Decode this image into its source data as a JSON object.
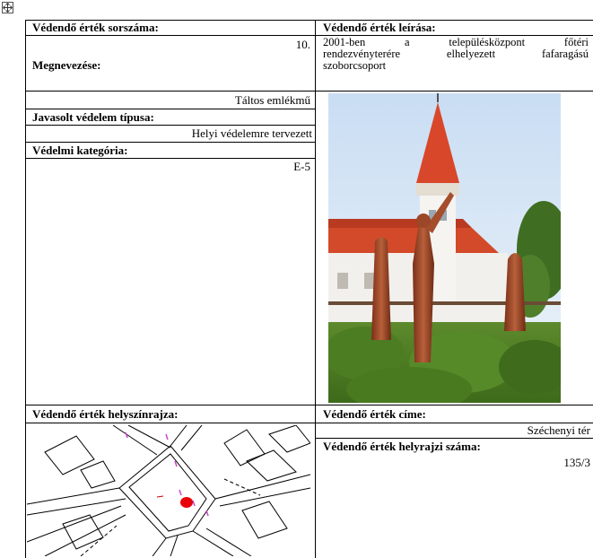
{
  "left_column": {
    "serial_label": "Védendő érték sorszáma:",
    "serial_value": "10.",
    "name_label": "Megnevezése:",
    "name_value": "Táltos emlékmű",
    "protection_type_label": "Javasolt védelem típusa:",
    "protection_type_value": "Helyi védelemre tervezett",
    "category_label": "Védelmi kategória:",
    "category_value": "E-5",
    "site_plan_label": "Védendő érték helyszínrajza:"
  },
  "right_column": {
    "description_label": "Védendő érték leírása:",
    "description_lines": [
      "2001-ben a településközpont főtéri",
      "rendezvényterére elhelyezett fafaragású",
      "szoborcsoport"
    ],
    "address_label": "Védendő érték címe:",
    "address_value": "Széchenyi tér",
    "lot_number_label": "Védendő érték helyrajzi száma:",
    "lot_number_value": "135/3"
  },
  "colors": {
    "border": "#000000",
    "map_red_dot": "#e8000b",
    "map_magenta_marks": "#cc44cc",
    "roof_red": "#d9472b",
    "sky": "#dbe9f7",
    "grass": "#4f7d24",
    "statue_wood": "#a8502f"
  },
  "icons": {
    "table_move_handle": "move-arrows-icon"
  }
}
